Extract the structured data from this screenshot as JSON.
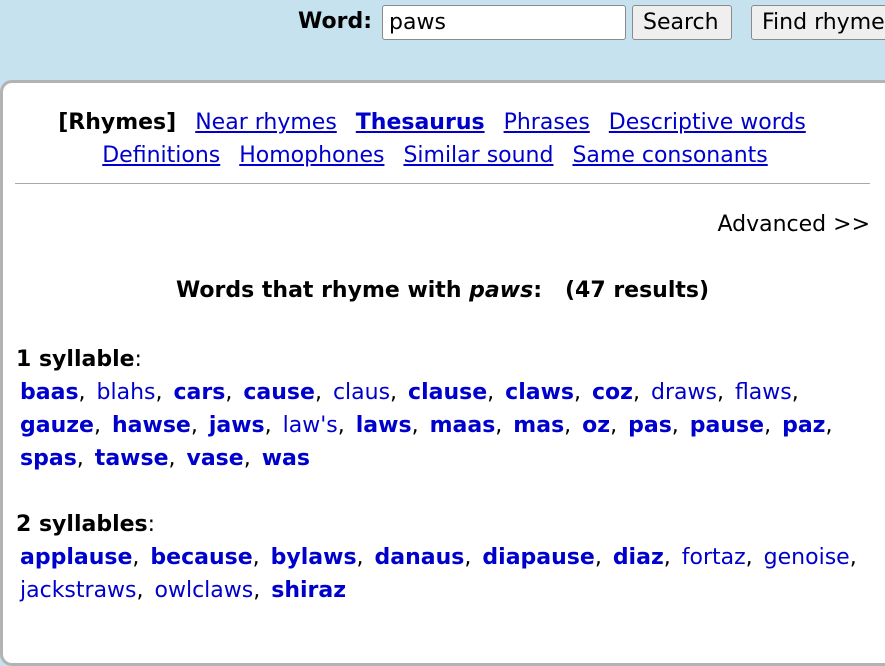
{
  "search": {
    "label": "Word:",
    "value": "paws",
    "search_button": "Search",
    "find_button": "Find rhymes"
  },
  "nav": {
    "current": "[Rhymes]",
    "links": [
      "Near rhymes",
      "Thesaurus",
      "Phrases",
      "Descriptive words",
      "Definitions",
      "Homophones",
      "Similar sound",
      "Same consonants"
    ]
  },
  "advanced": "Advanced >>",
  "heading": {
    "prefix": "Words that rhyme with",
    "word": "paws",
    "suffix": ":",
    "count": "(47 results)"
  },
  "sections": [
    {
      "title": "1 syllable",
      "words": [
        {
          "t": "baas",
          "b": true
        },
        {
          "t": "blahs",
          "b": false
        },
        {
          "t": "cars",
          "b": true
        },
        {
          "t": "cause",
          "b": true
        },
        {
          "t": "claus",
          "b": false
        },
        {
          "t": "clause",
          "b": true
        },
        {
          "t": "claws",
          "b": true
        },
        {
          "t": "coz",
          "b": true
        },
        {
          "t": "draws",
          "b": false
        },
        {
          "t": "flaws",
          "b": false
        },
        {
          "t": "gauze",
          "b": true
        },
        {
          "t": "hawse",
          "b": true
        },
        {
          "t": "jaws",
          "b": true
        },
        {
          "t": "law's",
          "b": false
        },
        {
          "t": "laws",
          "b": true
        },
        {
          "t": "maas",
          "b": true
        },
        {
          "t": "mas",
          "b": true
        },
        {
          "t": "oz",
          "b": true
        },
        {
          "t": "pas",
          "b": true
        },
        {
          "t": "pause",
          "b": true
        },
        {
          "t": "paz",
          "b": true
        },
        {
          "t": "spas",
          "b": true
        },
        {
          "t": "tawse",
          "b": true
        },
        {
          "t": "vase",
          "b": true
        },
        {
          "t": "was",
          "b": true
        }
      ]
    },
    {
      "title": "2 syllables",
      "words": [
        {
          "t": "applause",
          "b": true
        },
        {
          "t": "because",
          "b": true
        },
        {
          "t": "bylaws",
          "b": true
        },
        {
          "t": "danaus",
          "b": true
        },
        {
          "t": "diapause",
          "b": true
        },
        {
          "t": "diaz",
          "b": true
        },
        {
          "t": "fortaz",
          "b": false
        },
        {
          "t": "genoise",
          "b": false
        },
        {
          "t": "jackstraws",
          "b": false
        },
        {
          "t": "owlclaws",
          "b": false
        },
        {
          "t": "shiraz",
          "b": true
        }
      ]
    }
  ]
}
